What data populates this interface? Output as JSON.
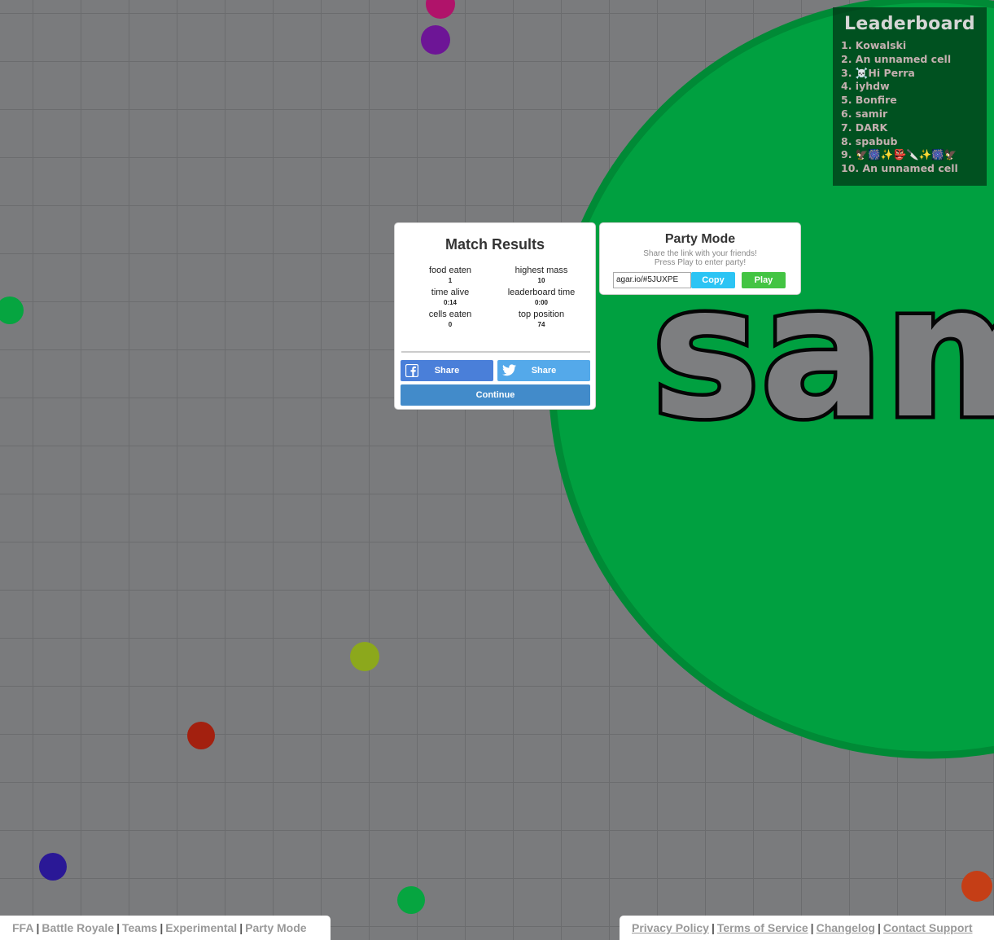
{
  "leaderboard": {
    "title": "Leaderboard",
    "entries": [
      "1. Kowalski",
      "2. An unnamed cell",
      "3. ☠️Hi Perra",
      "4. iyhdw",
      "5. Bonfire",
      "6. samir",
      "7. DARK",
      "8. spabub",
      "9. 🦅🎆✨👺🔪✨🎆🦅",
      "10. An unnamed cell"
    ]
  },
  "game": {
    "big_cell_name": "samir",
    "big_cell_color": "#00a040",
    "big_cell_border": "#008a36",
    "cells_colors": {
      "magenta": "#b0136a",
      "purple": "#6d1596",
      "green_left": "#06a540",
      "olive": "#8ca81c",
      "red": "#a3200f",
      "blue": "#2a1896",
      "green_bottom": "#06a540",
      "orange": "#c53e16"
    }
  },
  "match_results": {
    "title": "Match Results",
    "stats": [
      {
        "label": "food eaten",
        "value": "1"
      },
      {
        "label": "highest mass",
        "value": "10"
      },
      {
        "label": "time alive",
        "value": "0:14"
      },
      {
        "label": "leaderboard time",
        "value": "0:00"
      },
      {
        "label": "cells eaten",
        "value": "0"
      },
      {
        "label": "top position",
        "value": "74"
      }
    ],
    "share_facebook": "Share",
    "share_twitter": "Share",
    "continue": "Continue"
  },
  "party_mode": {
    "title": "Party Mode",
    "subtitle_1": "Share the link with your friends!",
    "subtitle_2": "Press Play to enter party!",
    "link": "agar.io/#5JUXPE",
    "copy": "Copy",
    "play": "Play"
  },
  "footer_left": [
    "FFA",
    "Battle Royale",
    "Teams",
    "Experimental",
    "Party Mode"
  ],
  "footer_right": [
    "Privacy Policy",
    "Terms of Service",
    "Changelog",
    "Contact Support"
  ]
}
